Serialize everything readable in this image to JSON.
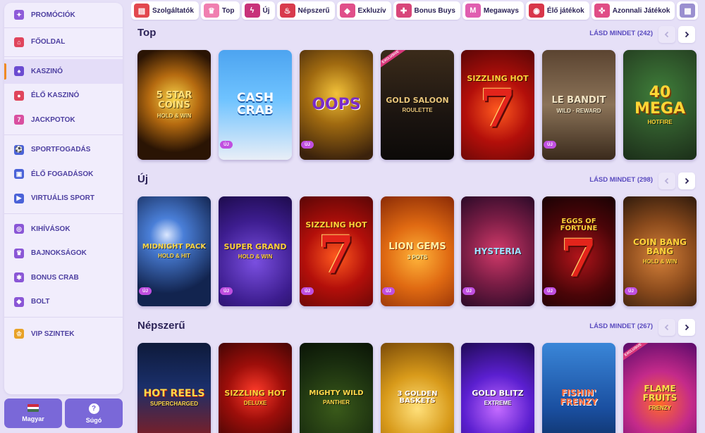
{
  "sidebar": {
    "groups": [
      [
        {
          "label": "PROMÓCIÓK",
          "icon": "promotions-icon",
          "color": "#8e5bd9"
        }
      ],
      [
        {
          "label": "FŐOLDAL",
          "icon": "home-icon",
          "color": "#e0455c"
        }
      ],
      [
        {
          "label": "KASZINÓ",
          "icon": "casino-icon",
          "color": "#6b4bd1",
          "active": true
        },
        {
          "label": "ÉLŐ KASZINÓ",
          "icon": "live-casino-icon",
          "color": "#e0455c"
        },
        {
          "label": "JACKPOTOK",
          "icon": "jackpot-icon",
          "color": "#d94fa0"
        }
      ],
      [
        {
          "label": "SPORTFOGADÁS",
          "icon": "sports-icon",
          "color": "#4a62d8"
        },
        {
          "label": "ÉLŐ FOGADÁSOK",
          "icon": "live-betting-icon",
          "color": "#4a62d8"
        },
        {
          "label": "VIRTUÁLIS SPORT",
          "icon": "virtual-sport-icon",
          "color": "#4a62d8"
        }
      ],
      [
        {
          "label": "KIHÍVÁSOK",
          "icon": "challenges-icon",
          "color": "#8a56d6"
        },
        {
          "label": "BAJNOKSÁGOK",
          "icon": "trophy-icon",
          "color": "#8a56d6"
        },
        {
          "label": "BONUS CRAB",
          "icon": "crab-icon",
          "color": "#8a56d6"
        },
        {
          "label": "BOLT",
          "icon": "shop-icon",
          "color": "#8a56d6"
        }
      ],
      [
        {
          "label": "VIP SZINTEK",
          "icon": "vip-crown-icon",
          "color": "#e8a227"
        }
      ]
    ]
  },
  "bottom": {
    "language_label": "Magyar",
    "help_label": "Súgó",
    "help_symbol": "?"
  },
  "categories": [
    {
      "label": "Szolgáltatók",
      "icon": "providers-icon",
      "color": "#e2484e"
    },
    {
      "label": "Top",
      "icon": "crown-icon",
      "color": "#f07fb0"
    },
    {
      "label": "Új",
      "icon": "lightning-icon",
      "color": "#c8327a"
    },
    {
      "label": "Népszerű",
      "icon": "fire-icon",
      "color": "#d83b4d"
    },
    {
      "label": "Exkluzív",
      "icon": "diamond-icon",
      "color": "#e04f8a"
    },
    {
      "label": "Bonus Buys",
      "icon": "gift-icon",
      "color": "#d8467a"
    },
    {
      "label": "Megaways",
      "icon": "megaways-icon",
      "color": "#e05eb0"
    },
    {
      "label": "Élő játékok",
      "icon": "live-games-icon",
      "color": "#d8364a"
    },
    {
      "label": "Azonnali Játékok",
      "icon": "gamepad-icon",
      "color": "#e04d86"
    },
    {
      "label": "",
      "icon": "more-icon",
      "color": "#9a8fd0"
    }
  ],
  "sections": [
    {
      "title": "Top",
      "see_all": "LÁSD MINDET (242)",
      "games": [
        {
          "title": "5 STAR COINS",
          "sub": "HOLD & WIN",
          "name": "5-star-coins"
        },
        {
          "title": "CASH CRAB",
          "sub": "",
          "name": "cash-crab",
          "badge": "ÚJ"
        },
        {
          "title": "OOPS",
          "sub": "",
          "name": "oops",
          "badge": "ÚJ"
        },
        {
          "title": "GOLD SALOON",
          "sub": "ROULETTE",
          "name": "gold-saloon-roulette",
          "ribbon": "EXCLUSIVE"
        },
        {
          "title": "Sizzling Hot",
          "sub": "",
          "name": "sizzling-hot"
        },
        {
          "title": "LE BANDIT",
          "sub": "WILD · REWARD",
          "name": "le-bandit",
          "badge": "ÚJ"
        },
        {
          "title": "40 MEGA",
          "sub": "HOTFIRE",
          "name": "40-mega-hotfire"
        }
      ]
    },
    {
      "title": "Új",
      "see_all": "LÁSD MINDET (298)",
      "games": [
        {
          "title": "MIDNIGHT PACK",
          "sub": "HOLD & HIT",
          "name": "midnight-pack",
          "badge": "ÚJ"
        },
        {
          "title": "SUPER GRAND",
          "sub": "HOLD & WIN",
          "name": "super-grand",
          "badge": "ÚJ"
        },
        {
          "title": "Sizzling Hot",
          "sub": "",
          "name": "sizzling-hot-new",
          "badge": "ÚJ"
        },
        {
          "title": "LION GEMS",
          "sub": "3 POTS",
          "name": "lion-gems",
          "badge": "ÚJ"
        },
        {
          "title": "HYSTERIA",
          "sub": "",
          "name": "hysteria",
          "badge": "ÚJ"
        },
        {
          "title": "Eggs of Fortune",
          "sub": "",
          "name": "eggs-of-fortune",
          "badge": "ÚJ"
        },
        {
          "title": "COIN BANG BANG",
          "sub": "HOLD & WIN",
          "name": "coin-bang-bang",
          "badge": "ÚJ"
        }
      ]
    },
    {
      "title": "Népszerű",
      "see_all": "LÁSD MINDET (267)",
      "games": [
        {
          "title": "HOT REELS",
          "sub": "SUPERCHARGED",
          "name": "hot-reels"
        },
        {
          "title": "Sizzling Hot",
          "sub": "deluxe",
          "name": "sizzling-hot-deluxe"
        },
        {
          "title": "MIGHTY WILD",
          "sub": "PANTHER",
          "name": "mighty-wild-panther"
        },
        {
          "title": "3 GOLDEN BASKETS",
          "sub": "",
          "name": "3-golden-baskets"
        },
        {
          "title": "GOLD BLITZ",
          "sub": "EXTREME",
          "name": "gold-blitz-extreme"
        },
        {
          "title": "FISHIN' FRENZY",
          "sub": "",
          "name": "fishin-frenzy"
        },
        {
          "title": "Flame Fruits",
          "sub": "FRENZY",
          "name": "flame-fruits-frenzy",
          "ribbon": "EXCLUSIVE"
        }
      ]
    }
  ]
}
